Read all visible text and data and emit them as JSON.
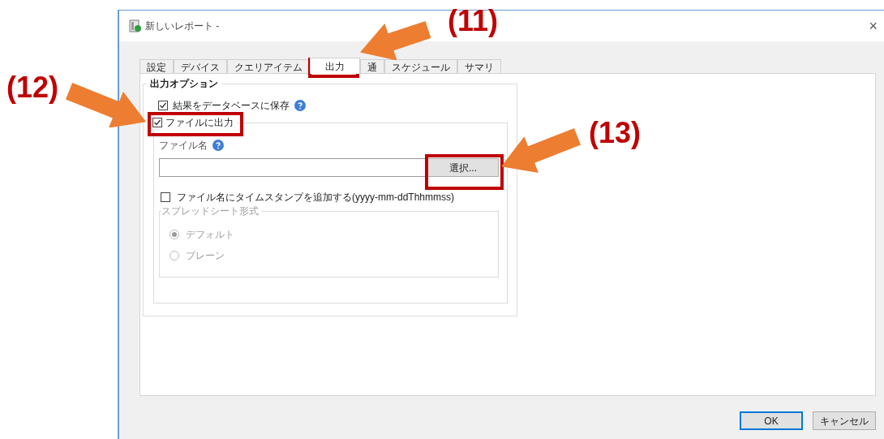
{
  "window": {
    "title": "新しいレポート -",
    "close": "×"
  },
  "tabs": [
    {
      "label": "設定",
      "selected": false
    },
    {
      "label": "デバイス",
      "selected": false
    },
    {
      "label": "クエリアイテム",
      "selected": false
    },
    {
      "label": "出力",
      "selected": true
    },
    {
      "label": "通",
      "selected": false
    },
    {
      "label": "スケジュール",
      "selected": false
    },
    {
      "label": "サマリ",
      "selected": false
    }
  ],
  "output_options": {
    "title": "出力オプション",
    "save_to_db": {
      "label": "結果をデータベースに保存",
      "checked": true
    },
    "file_output": {
      "label": "ファイルに出力",
      "checked": true,
      "file_name_label": "ファイル名",
      "select_button": "選択...",
      "timestamp": {
        "label": "ファイル名にタイムスタンプを追加する(yyyy-mm-ddThhmmss)",
        "checked": false
      },
      "spreadsheet": {
        "title": "スプレッドシート形式",
        "disabled": true,
        "options": [
          {
            "label": "デフォルト",
            "selected": true
          },
          {
            "label": "プレーン",
            "selected": false
          }
        ]
      }
    }
  },
  "buttons": [
    {
      "label": "OK",
      "default": true
    },
    {
      "label": "キャンセル",
      "default": false
    }
  ],
  "annotations": [
    {
      "label": "(11)"
    },
    {
      "label": "(12)"
    },
    {
      "label": "(13)"
    }
  ]
}
